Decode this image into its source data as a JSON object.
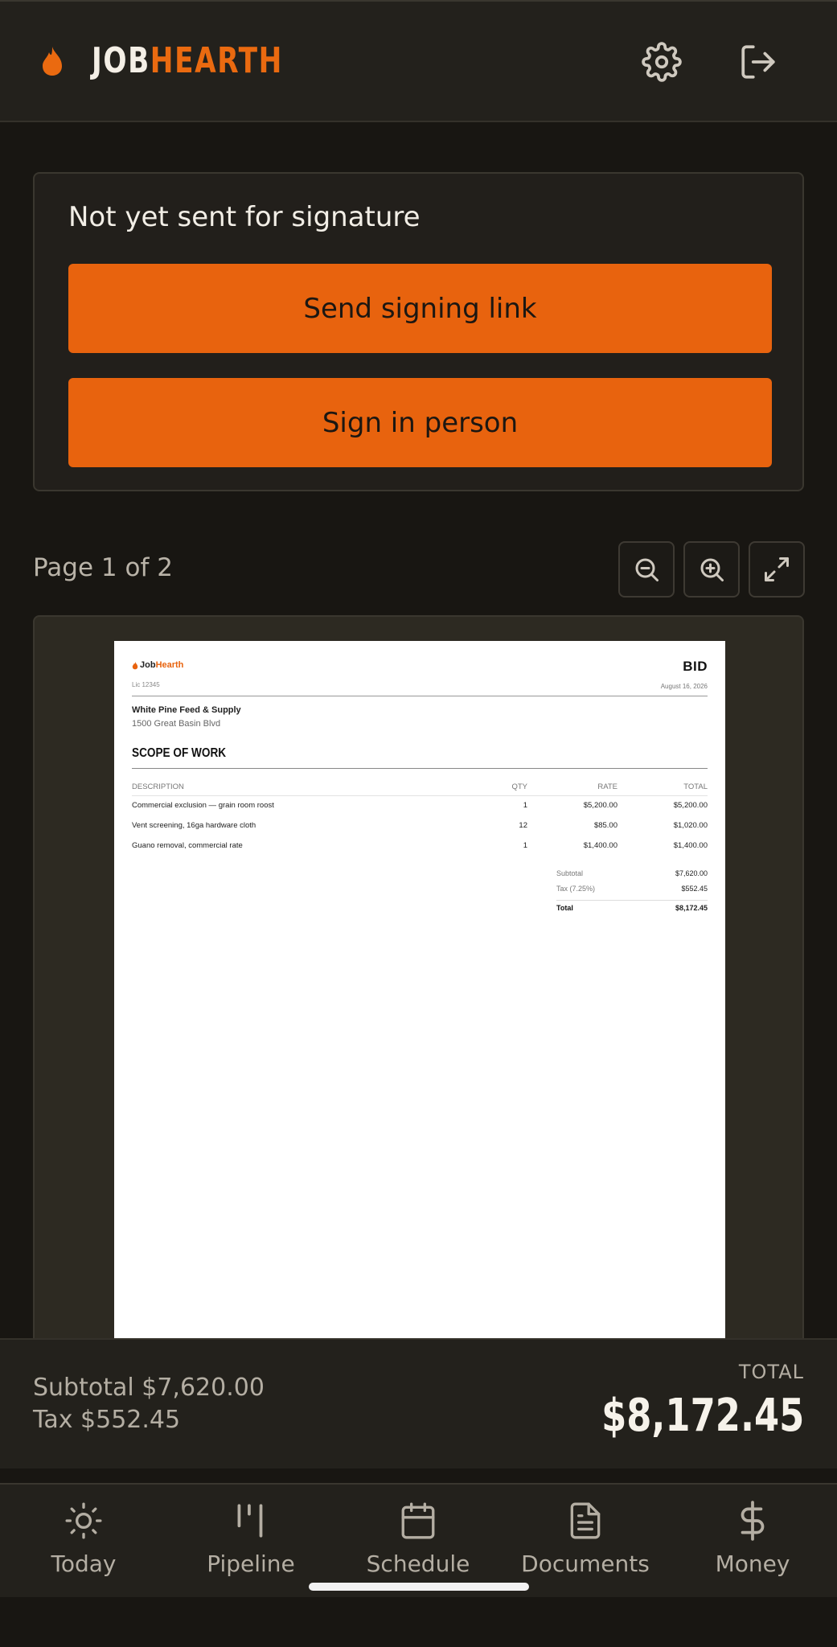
{
  "header": {
    "brand_part1": "JOB",
    "brand_part2": "HEARTH",
    "icons": [
      "flame-icon",
      "gear-icon",
      "logout-icon"
    ]
  },
  "signature": {
    "status": "Not yet sent for signature",
    "send_link_label": "Send signing link",
    "sign_in_person_label": "Sign in person"
  },
  "preview": {
    "page_label": "Page 1 of 2",
    "controls": [
      "zoom-out-icon",
      "zoom-in-icon",
      "expand-icon"
    ]
  },
  "document": {
    "logo_part1": "Job",
    "logo_part2": "Hearth",
    "license": "Lic 12345",
    "type": "BID",
    "date": "August 16, 2026",
    "client_name": "White Pine Feed & Supply",
    "client_address": "1500 Great Basin Blvd",
    "section_title": "SCOPE OF WORK",
    "columns": [
      "DESCRIPTION",
      "QTY",
      "RATE",
      "TOTAL"
    ],
    "rows": [
      {
        "description": "Commercial exclusion — grain room roost",
        "qty": "1",
        "rate": "$5,200.00",
        "total": "$5,200.00"
      },
      {
        "description": "Vent screening, 16ga hardware cloth",
        "qty": "12",
        "rate": "$85.00",
        "total": "$1,020.00"
      },
      {
        "description": "Guano removal, commercial rate",
        "qty": "1",
        "rate": "$1,400.00",
        "total": "$1,400.00"
      }
    ],
    "subtotal_label": "Subtotal",
    "subtotal_value": "$7,620.00",
    "tax_label": "Tax (7.25%)",
    "tax_value": "$552.45",
    "total_label": "Total",
    "total_value": "$8,172.45"
  },
  "totals_bar": {
    "subtotal": "Subtotal $7,620.00",
    "tax": "Tax $552.45",
    "total_label": "TOTAL",
    "total_value": "$8,172.45"
  },
  "nav": {
    "items": [
      {
        "label": "Today",
        "icon": "sun-icon"
      },
      {
        "label": "Pipeline",
        "icon": "pipeline-icon"
      },
      {
        "label": "Schedule",
        "icon": "calendar-icon"
      },
      {
        "label": "Documents",
        "icon": "document-icon"
      },
      {
        "label": "Money",
        "icon": "dollar-icon"
      }
    ]
  },
  "colors": {
    "accent": "#e8630e",
    "background": "#181612",
    "surface": "#23211c"
  }
}
